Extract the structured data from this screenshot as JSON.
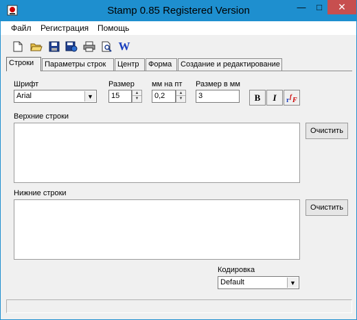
{
  "window": {
    "title": "Stamp 0.85 Registered Version",
    "close_label": "✕",
    "min_label": "—",
    "max_label": "□"
  },
  "menu": [
    "Файл",
    "Регистрация",
    "Помощь"
  ],
  "toolbar": {
    "word_label": "W"
  },
  "tabs": [
    "Строки",
    "Параметры строк",
    "Центр",
    "Форма",
    "Создание и редактирование"
  ],
  "font": {
    "label": "Шрифт",
    "value": "Arial"
  },
  "size": {
    "label": "Размер",
    "value": "15"
  },
  "mm_per_pt": {
    "label": "мм на пт",
    "value": "0,2"
  },
  "size_mm": {
    "label": "Размер в мм",
    "value": "3"
  },
  "format": {
    "bold": "B",
    "italic": "I"
  },
  "upper": {
    "label": "Верхние строки",
    "clear": "Очистить"
  },
  "lower": {
    "label": "Нижние строки",
    "clear": "Очистить"
  },
  "encoding": {
    "label": "Кодировка",
    "value": "Default"
  }
}
